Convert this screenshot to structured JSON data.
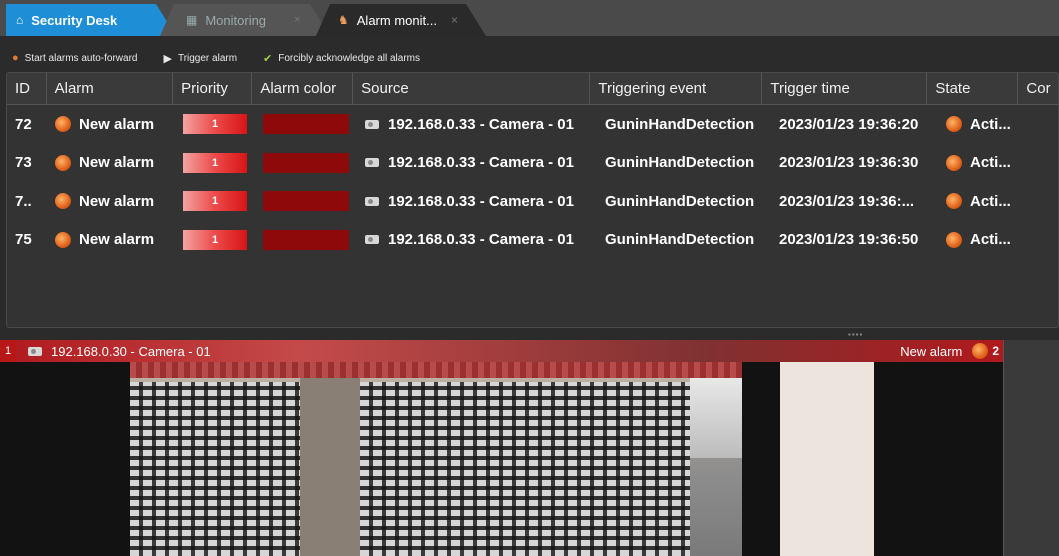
{
  "tabs": [
    {
      "label": "Security Desk",
      "icon": "home-icon"
    },
    {
      "label": "Monitoring",
      "icon": "monitoring-icon"
    },
    {
      "label": "Alarm monit...",
      "icon": "alarm-monitoring-icon",
      "close": "×"
    }
  ],
  "toolbar": {
    "auto_forward": "Start alarms auto-forward",
    "trigger": "Trigger alarm",
    "ack_all": "Forcibly acknowledge all alarms"
  },
  "columns": [
    "ID",
    "Alarm",
    "Priority",
    "Alarm color",
    "Source",
    "Triggering event",
    "Trigger time",
    "State",
    "Cor"
  ],
  "rows": [
    {
      "id": "72",
      "alarm": "New alarm",
      "priority": "1",
      "source": "192.168.0.33 - Camera - 01",
      "event": "GuninHandDetection",
      "time": "2023/01/23 19:36:20",
      "state": "Acti..."
    },
    {
      "id": "73",
      "alarm": "New alarm",
      "priority": "1",
      "source": "192.168.0.33 - Camera - 01",
      "event": "GuninHandDetection",
      "time": "2023/01/23 19:36:30",
      "state": "Acti..."
    },
    {
      "id": "7..",
      "alarm": "New alarm",
      "priority": "1",
      "source": "192.168.0.33 - Camera - 01",
      "event": "GuninHandDetection",
      "time": "2023/01/23 19:36:...",
      "state": "Acti..."
    },
    {
      "id": "75",
      "alarm": "New alarm",
      "priority": "1",
      "source": "192.168.0.33 - Camera - 01",
      "event": "GuninHandDetection",
      "time": "2023/01/23 19:36:50",
      "state": "Acti..."
    }
  ],
  "video": {
    "tile_number": "1",
    "camera": "192.168.0.30 - Camera - 01",
    "alarm": "New alarm",
    "count": "2"
  },
  "colors": {
    "accent": "#1e8fd6",
    "alarm_color": "#8e0a0a",
    "tile_bar": "#b0191d"
  }
}
